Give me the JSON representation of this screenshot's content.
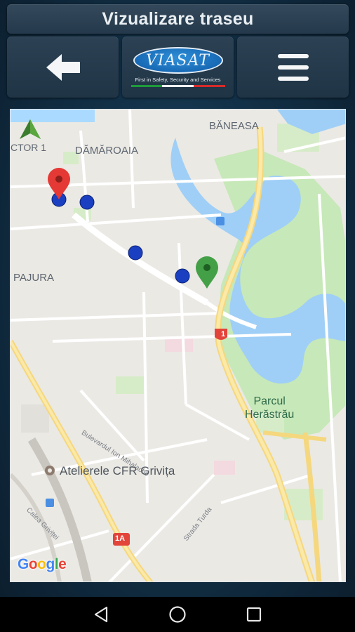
{
  "header": {
    "title": "Vizualizare traseu"
  },
  "toolbar": {
    "back_icon": "arrow-left-icon",
    "menu_icon": "hamburger-menu-icon",
    "logo": {
      "brand": "VIASAT",
      "tagline": "First in Safety, Security and Services",
      "stripe_colors": [
        "#1e9a3a",
        "#ffffff",
        "#d62b2b"
      ]
    }
  },
  "map": {
    "labels": {
      "baneasa": "BĂNEASA",
      "damaroaia": "DĂMĂROAIA",
      "sector": "CTOR 1",
      "pajura": "PAJURA",
      "park_line1": "Parcul",
      "park_line2": "Herăstrău",
      "poi": "Atelierele CFR Grivița",
      "road_1": "1",
      "road_1a": "1A",
      "street_mihalache": "Bulevardul Ion Mihalache",
      "street_grivitei": "Calea Griviței",
      "street_turda": "Strada Turda"
    },
    "attribution": "Google",
    "markers": {
      "start_color": "#e53935",
      "end_color": "#43a047",
      "waypoint_color": "#1a3fc0"
    },
    "compass_icon": "north-arrow-icon"
  },
  "navbar": {
    "back_icon": "triangle-back-icon",
    "home_icon": "circle-home-icon",
    "recents_icon": "square-recents-icon"
  }
}
